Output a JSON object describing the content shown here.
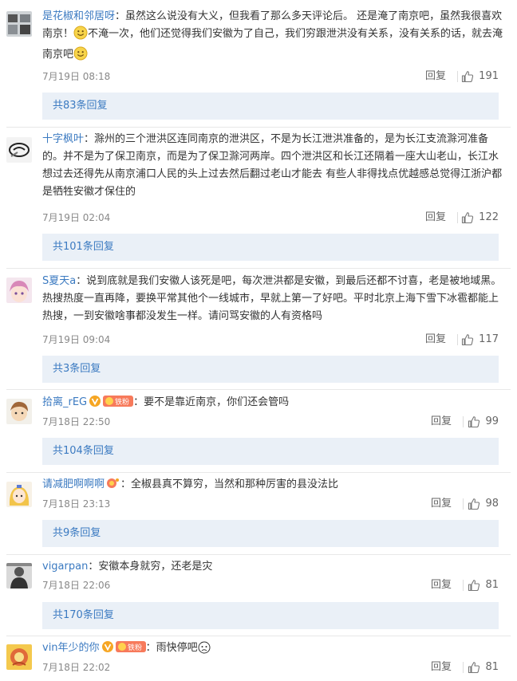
{
  "comments": [
    {
      "user": "是花椒和邻居呀",
      "text_a": "虽然这么说没有大义，但我看了那么多天评论后。 还是淹了南京吧，虽然我很喜欢南京！",
      "text_b": "不淹一次，他们还觉得我们安徽为了自己，我们穷跟泄洪没有关系，没有关系的话，就去淹南京吧",
      "date": "7月19日 08:18",
      "reply": "回复",
      "likes": "191",
      "more": "共83条回复"
    },
    {
      "user": "十字枫叶",
      "text_a": "滁州的三个泄洪区连同南京的泄洪区，不是为长江泄洪准备的，是为长江支流滁河准备的。并不是为了保卫南京，而是为了保卫滁河两岸。四个泄洪区和长江还隔着一座大山老山，长江水想过去还得先从南京浦口人民的头上过去然后翻过老山才能去 有些人非得找点优越感总觉得江浙沪都是牺牲安徽才保住的",
      "date": "7月19日 02:04",
      "reply": "回复",
      "likes": "122",
      "more": "共101条回复"
    },
    {
      "user": "S夏天a",
      "text_a": "说到底就是我们安徽人该死是吧，每次泄洪都是安徽，到最后还都不讨喜，老是被地域黑。热搜热度一直再降，要换平常其他个一线城市，早就上第一了好吧。平时北京上海下雪下冰雹都能上热搜，一到安徽啥事都没发生一样。请问骂安徽的人有资格吗",
      "date": "7月19日 09:04",
      "reply": "回复",
      "likes": "117",
      "more": "共3条回复"
    },
    {
      "user": "拾离_rEG",
      "text_a": "要不是靠近南京，你们还会管吗",
      "date": "7月18日 22:50",
      "reply": "回复",
      "likes": "99",
      "more": "共104条回复",
      "badge_text": "铁粉"
    },
    {
      "user": "请减肥啊啊啊",
      "text_a": "全椒县真不算穷，当然和那种厉害的县没法比",
      "date": "7月18日 23:13",
      "reply": "回复",
      "likes": "98",
      "more": "共9条回复"
    },
    {
      "user": "vigarpan",
      "text_a": "安徽本身就穷，还老是灾",
      "date": "7月18日 22:06",
      "reply": "回复",
      "likes": "81",
      "more": "共170条回复"
    },
    {
      "user": "vin年少的你",
      "text_a": "雨快停吧",
      "date": "7月18日 22:02",
      "reply": "回复",
      "likes": "81",
      "badge_text": "铁粉"
    }
  ],
  "colors": {
    "link": "#3b7ac1",
    "more_bg": "#eaf0f7",
    "text": "#333333",
    "meta": "#888888"
  },
  "icons": [
    "avatar",
    "smile-emoji-icon",
    "verified-v-icon",
    "fan-badge-icon",
    "thumbs-up-icon"
  ]
}
